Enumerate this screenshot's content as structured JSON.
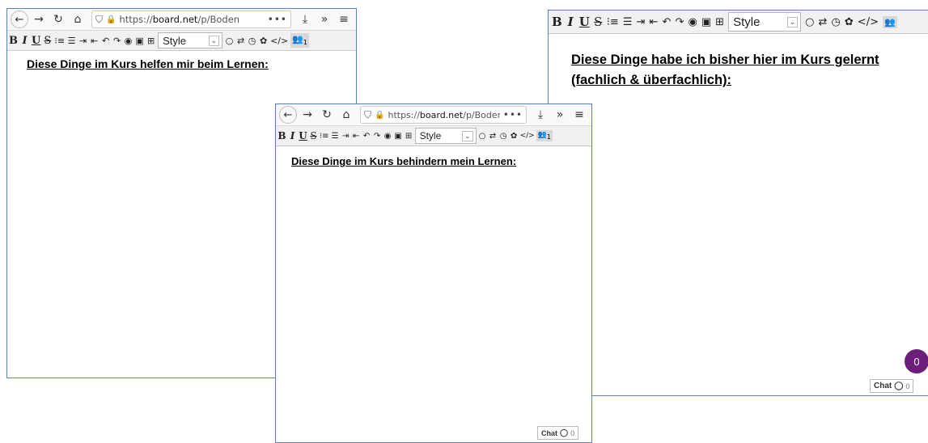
{
  "browser": {
    "back_icon": "←",
    "forward_icon": "→",
    "reload_icon": "↻",
    "home_icon": "⌂",
    "shield_icon": "⛉",
    "lock_icon": "🔒",
    "url_prefix": "https://",
    "url_host": "board.net",
    "url_path": "/p/Boden",
    "more_icon": "•••",
    "download_icon": "⤓",
    "overflow_icon": "»",
    "menu_icon": "≡"
  },
  "toolbar": {
    "bold": "B",
    "italic": "I",
    "underline": "U",
    "strike": "S",
    "ordered_list": "⁝≡",
    "bullet_list": "☰",
    "indent": "⇥",
    "outdent": "⇤",
    "undo": "↶",
    "redo": "↷",
    "eye": "◉",
    "image": "▣",
    "table": "⊞",
    "style_label": "Style",
    "style_arrow": "⌄",
    "circle": "○",
    "sync": "⇄",
    "clock": "◷",
    "gear": "✿",
    "code": "</>",
    "users": "👥"
  },
  "windows": {
    "left": {
      "heading": "Diese Dinge im Kurs helfen mir beim Lernen:",
      "users_count": "1"
    },
    "middle": {
      "heading": "Diese Dinge im Kurs behindern mein Lernen:",
      "users_count": "1",
      "chat_label": "Chat",
      "chat_count": "0"
    },
    "right": {
      "heading": "Diese Dinge habe ich bisher hier im Kurs gelernt (fachlich & überfachlich):",
      "chat_label": "Chat",
      "chat_count": "0",
      "badge": "0"
    }
  }
}
